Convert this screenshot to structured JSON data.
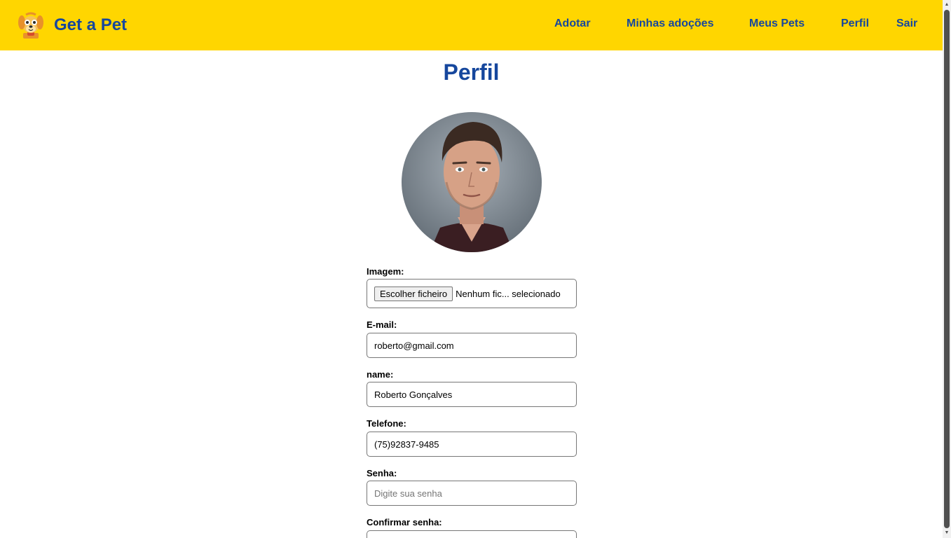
{
  "navbar": {
    "brand": "Get a Pet",
    "logo_icon": "dog-icon",
    "links": [
      "Adotar",
      "Minhas adoções",
      "Meus Pets",
      "Perfil",
      "Sair"
    ]
  },
  "page": {
    "title": "Perfil"
  },
  "form": {
    "image": {
      "label": "Imagem:",
      "button": "Escolher ficheiro",
      "status": "Nenhum fic... selecionado"
    },
    "email": {
      "label": "E-mail:",
      "value": "roberto@gmail.com"
    },
    "name": {
      "label": "name:",
      "value": "Roberto Gonçalves"
    },
    "phone": {
      "label": "Telefone:",
      "value": "(75)92837-9485"
    },
    "password": {
      "label": "Senha:",
      "value": "",
      "placeholder": "Digite sua senha"
    },
    "confirm_password": {
      "label": "Confirmar senha:",
      "value": ""
    }
  },
  "colors": {
    "navbar_bg": "#ffd600",
    "brand": "#16479d"
  }
}
